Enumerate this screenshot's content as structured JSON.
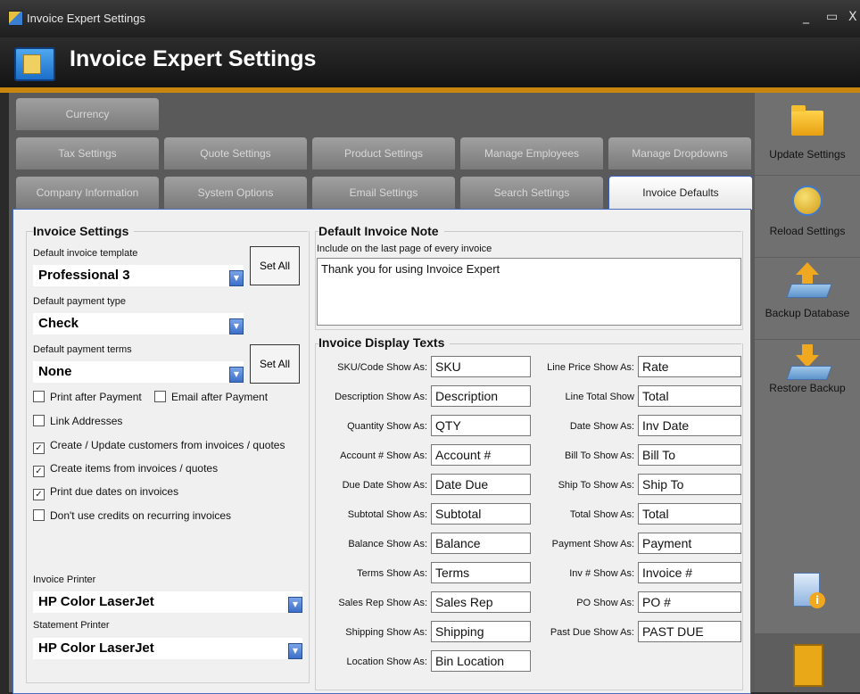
{
  "window": {
    "title": "Invoice Expert Settings",
    "controls": [
      "_",
      "▭",
      "X"
    ]
  },
  "header": {
    "title": "Invoice Expert Settings"
  },
  "tabs": {
    "row1": [
      "Currency"
    ],
    "row2": [
      "Tax Settings",
      "Quote Settings",
      "Product Settings",
      "Manage Employees",
      "Manage Dropdowns"
    ],
    "row3": [
      "Company Information",
      "System Options",
      "Email Settings",
      "Search Settings",
      "Invoice Defaults"
    ],
    "active": "Invoice Defaults"
  },
  "invoice_settings": {
    "title": "Invoice Settings",
    "template_label": "Default invoice template",
    "template_value": "Professional 3",
    "payment_type_label": "Default payment type",
    "payment_type_value": "Check",
    "payment_terms_label": "Default payment terms",
    "payment_terms_value": "None",
    "set_all_label": "Set All",
    "checkboxes": [
      {
        "label": "Print after Payment",
        "checked": false
      },
      {
        "label": "Email after Payment",
        "checked": false
      },
      {
        "label": "Link Addresses",
        "checked": false
      },
      {
        "label": "Create / Update customers from invoices / quotes",
        "checked": true
      },
      {
        "label": "Create items from invoices / quotes",
        "checked": true
      },
      {
        "label": "Print due dates on invoices",
        "checked": true
      },
      {
        "label": "Don't use credits on recurring invoices",
        "checked": false
      }
    ],
    "invoice_printer_label": "Invoice Printer",
    "invoice_printer_value": "HP Color LaserJet",
    "statement_printer_label": "Statement Printer",
    "statement_printer_value": "HP Color LaserJet"
  },
  "default_note": {
    "title": "Default Invoice Note",
    "subtitle": "Include on the last page of every invoice",
    "text": "Thank you for using Invoice Expert"
  },
  "display_texts": {
    "title": "Invoice Display Texts",
    "left": [
      {
        "label": "SKU/Code Show As:",
        "value": "SKU"
      },
      {
        "label": "Description Show As:",
        "value": "Description"
      },
      {
        "label": "Quantity Show As:",
        "value": "QTY"
      },
      {
        "label": "Account # Show As:",
        "value": "Account #"
      },
      {
        "label": "Due Date Show As:",
        "value": "Date Due"
      },
      {
        "label": "Subtotal Show As:",
        "value": "Subtotal"
      },
      {
        "label": "Balance Show As:",
        "value": "Balance"
      },
      {
        "label": "Terms Show As:",
        "value": "Terms"
      },
      {
        "label": "Sales Rep Show As:",
        "value": "Sales Rep"
      },
      {
        "label": "Shipping Show As:",
        "value": "Shipping"
      },
      {
        "label": "Location Show As:",
        "value": "Bin Location"
      }
    ],
    "right": [
      {
        "label": "Line Price Show As:",
        "value": "Rate"
      },
      {
        "label": "Line Total Show",
        "value": "Total"
      },
      {
        "label": "Date Show As:",
        "value": "Inv Date"
      },
      {
        "label": "Bill To Show As:",
        "value": "Bill To"
      },
      {
        "label": "Ship To Show As:",
        "value": "Ship To"
      },
      {
        "label": "Total Show As:",
        "value": "Total"
      },
      {
        "label": "Payment Show As:",
        "value": "Payment"
      },
      {
        "label": "Inv # Show As:",
        "value": "Invoice #"
      },
      {
        "label": "PO Show As:",
        "value": "PO #"
      },
      {
        "label": "Past Due Show As:",
        "value": "PAST DUE"
      }
    ]
  },
  "sidebar": {
    "buttons": [
      {
        "label": "Update Settings",
        "icon": "folder-icon"
      },
      {
        "label": "Reload Settings",
        "icon": "reload-icon"
      },
      {
        "label": "Backup Database",
        "icon": "backup-icon"
      },
      {
        "label": "Restore Backup",
        "icon": "restore-icon"
      }
    ],
    "bottom_icons": [
      "info-icon",
      "exit-door-icon"
    ]
  }
}
